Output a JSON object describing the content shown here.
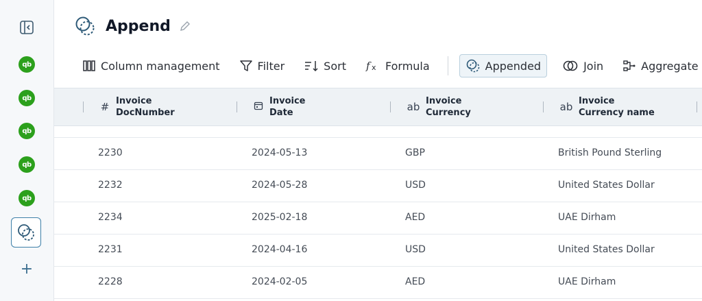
{
  "sidebar": {
    "qb_label": "qb",
    "add_label": "+"
  },
  "header": {
    "title": "Append"
  },
  "toolbar": {
    "column_management": "Column management",
    "filter": "Filter",
    "sort": "Sort",
    "formula": "Formula",
    "appended": "Appended",
    "join": "Join",
    "aggregate": "Aggregate"
  },
  "table": {
    "columns": [
      {
        "icon": "#",
        "line1": "Invoice",
        "line2": "DocNumber"
      },
      {
        "icon": "calendar",
        "line1": "Invoice",
        "line2": "Date"
      },
      {
        "icon": "ab",
        "line1": "Invoice",
        "line2": "Currency"
      },
      {
        "icon": "ab",
        "line1": "Invoice",
        "line2": "Currency name"
      }
    ],
    "rows": [
      [
        "2230",
        "2024-05-13",
        "GBP",
        "British Pound Sterling"
      ],
      [
        "2232",
        "2024-05-28",
        "USD",
        "United States Dollar"
      ],
      [
        "2234",
        "2025-02-18",
        "AED",
        "UAE Dirham"
      ],
      [
        "2231",
        "2024-04-16",
        "USD",
        "United States Dollar"
      ],
      [
        "2228",
        "2024-02-05",
        "AED",
        "UAE Dirham"
      ]
    ]
  },
  "colors": {
    "accent": "#3d7fa8",
    "qb_green": "#2ca01c"
  }
}
